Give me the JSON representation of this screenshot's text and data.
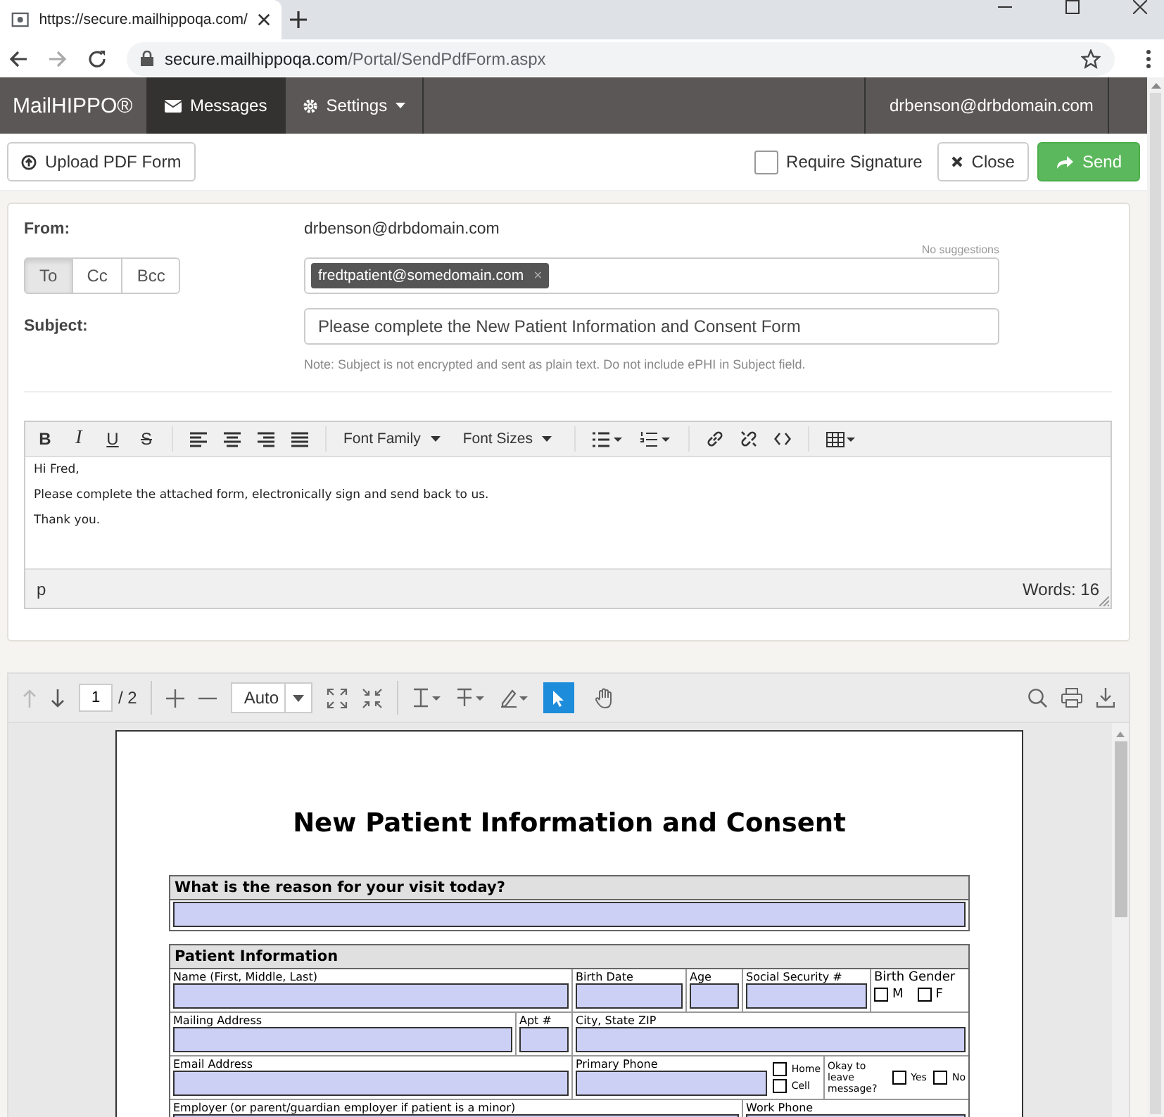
{
  "browser": {
    "tab_title": "https://secure.mailhippoqa.com/",
    "url_host": "secure.mailhippoqa.com",
    "url_path": "/Portal/SendPdfForm.aspx"
  },
  "navbar": {
    "brand": "MailHIPPO®",
    "items": [
      {
        "label": "Messages",
        "kind": "envelope",
        "selected": true
      },
      {
        "label": "Settings",
        "kind": "gear",
        "selected": false
      }
    ],
    "user": "drbenson@drbdomain.com"
  },
  "actions": {
    "upload": "Upload PDF Form",
    "require_signature": {
      "label": "Require Signature",
      "checked": false
    },
    "close": "Close",
    "send": "Send"
  },
  "compose": {
    "from_label": "From:",
    "from": "drbenson@drbdomain.com",
    "recipient_tabs": [
      {
        "label": "To",
        "selected": true
      },
      {
        "label": "Cc",
        "selected": false
      },
      {
        "label": "Bcc",
        "selected": false
      }
    ],
    "suggestions": "No suggestions",
    "recipients": [
      "fredtpatient@somedomain.com"
    ],
    "chip_remove": "×",
    "subject_label": "Subject:",
    "subject": "Please complete the New Patient Information and Consent Form",
    "note": "Note: Subject is not encrypted and sent as plain text. Do not include ePHI in Subject field."
  },
  "editor": {
    "format": [
      "B",
      "I",
      "U",
      "S"
    ],
    "font_family": "Font Family",
    "font_sizes": "Font Sizes",
    "lines": [
      "Hi Fred,",
      "Please complete the attached form, electronically sign and send back to us.",
      "Thank you."
    ],
    "path": "p",
    "word_count": "Words: 16"
  },
  "viewer": {
    "page": "1",
    "page_count": "/ 2",
    "zoom": "Auto",
    "tools": [
      {
        "kind": "pointer",
        "selected": true
      },
      {
        "kind": "hand",
        "selected": false
      }
    ]
  },
  "form": {
    "title": "New Patient Information and Consent",
    "sections": [
      {
        "heading": "What is the reason for your visit today?",
        "lines": [
          {
            "fields": [
              {
                "kind": "field"
              }
            ]
          }
        ]
      },
      {
        "heading": "Patient Information",
        "lines": [
          {
            "fields": [
              {
                "kind": "field",
                "label": "Name (First, Middle, Last)"
              },
              {
                "kind": "field",
                "label": "Birth Date"
              },
              {
                "kind": "field",
                "label": "Age"
              },
              {
                "kind": "field",
                "label": "Social Security #"
              },
              {
                "kind": "gender",
                "label": "Birth Gender",
                "options": [
                  {
                    "label": "M",
                    "checked": false
                  },
                  {
                    "label": "F",
                    "checked": false
                  }
                ]
              }
            ]
          },
          {
            "fields": [
              {
                "kind": "field",
                "label": "Mailing Address"
              },
              {
                "kind": "field",
                "label": "Apt #"
              },
              {
                "kind": "field",
                "label": "City, State  ZIP"
              }
            ]
          },
          {
            "fields": [
              {
                "kind": "field",
                "label": "Email Address"
              },
              {
                "kind": "phone",
                "label": "Primary Phone",
                "options": [
                  {
                    "label": "Home",
                    "checked": false
                  },
                  {
                    "label": "Cell",
                    "checked": false
                  }
                ]
              },
              {
                "kind": "consent",
                "label": "Okay to leave message?",
                "options": [
                  {
                    "label": "Yes",
                    "checked": false
                  },
                  {
                    "label": "No",
                    "checked": false
                  }
                ]
              }
            ]
          },
          {
            "fields": [
              {
                "kind": "field",
                "label": "Employer (or parent/guardian employer if patient is a minor)"
              },
              {
                "kind": "field",
                "label": "Work Phone"
              }
            ]
          }
        ]
      }
    ]
  }
}
